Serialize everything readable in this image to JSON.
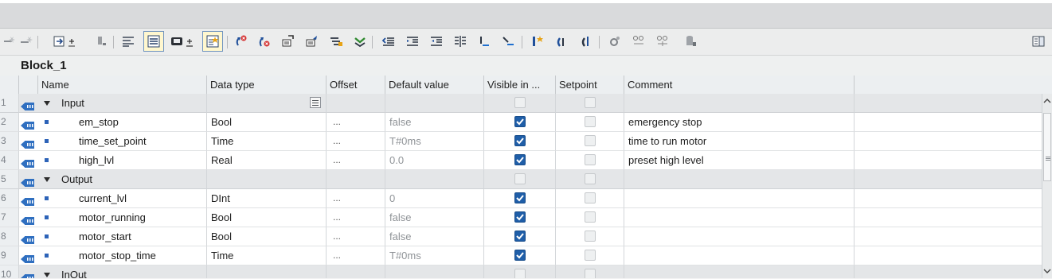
{
  "block": {
    "title": "Block_1"
  },
  "columns": {
    "name": "Name",
    "data_type": "Data type",
    "offset": "Offset",
    "default_value": "Default value",
    "visible_in": "Visible in ...",
    "setpoint": "Setpoint",
    "comment": "Comment"
  },
  "rows": [
    {
      "num": "1",
      "kind": "group",
      "name": "Input",
      "data_type": "",
      "offset": "",
      "default_value": "",
      "visible": false,
      "setpoint": false,
      "comment": ""
    },
    {
      "num": "2",
      "kind": "item",
      "name": "em_stop",
      "data_type": "Bool",
      "offset": "...",
      "default_value": "false",
      "visible": true,
      "setpoint": false,
      "comment": "emergency stop"
    },
    {
      "num": "3",
      "kind": "item",
      "name": "time_set_point",
      "data_type": "Time",
      "offset": "...",
      "default_value": "T#0ms",
      "visible": true,
      "setpoint": false,
      "comment": "time to run motor"
    },
    {
      "num": "4",
      "kind": "item",
      "name": "high_lvl",
      "data_type": "Real",
      "offset": "...",
      "default_value": "0.0",
      "visible": true,
      "setpoint": false,
      "comment": "preset high level"
    },
    {
      "num": "5",
      "kind": "group",
      "name": "Output",
      "data_type": "",
      "offset": "",
      "default_value": "",
      "visible": false,
      "setpoint": false,
      "comment": ""
    },
    {
      "num": "6",
      "kind": "item",
      "name": "current_lvl",
      "data_type": "DInt",
      "offset": "...",
      "default_value": "0",
      "visible": true,
      "setpoint": false,
      "comment": ""
    },
    {
      "num": "7",
      "kind": "item",
      "name": "motor_running",
      "data_type": "Bool",
      "offset": "...",
      "default_value": "false",
      "visible": true,
      "setpoint": false,
      "comment": ""
    },
    {
      "num": "8",
      "kind": "item",
      "name": "motor_start",
      "data_type": "Bool",
      "offset": "...",
      "default_value": "false",
      "visible": true,
      "setpoint": false,
      "comment": ""
    },
    {
      "num": "9",
      "kind": "item",
      "name": "motor_stop_time",
      "data_type": "Time",
      "offset": "...",
      "default_value": "T#0ms",
      "visible": true,
      "setpoint": false,
      "comment": ""
    },
    {
      "num": "10",
      "kind": "group",
      "name": "InOut",
      "data_type": "",
      "offset": "",
      "default_value": "",
      "visible": false,
      "setpoint": false,
      "comment": ""
    }
  ],
  "toolbar": [
    "insert-row-icon",
    "add-row-icon",
    "expand-all-icon",
    "collapse-icon",
    "list-view-icon",
    "structure-view-icon",
    "monitor-icon",
    "snapshot-icon",
    "reset-start-values-icon",
    "reset-values-icon",
    "load-start-values-icon",
    "load-snapshot-icon",
    "copy-snapshot-icon",
    "load-to-start-icon",
    "indent-left-icon",
    "indent-right-icon",
    "outdent-icon",
    "split-icon",
    "filter-up-icon",
    "filter-down-icon",
    "new-tag-icon",
    "refresh-tag-icon",
    "sync-icon",
    "settings-icon",
    "compare-icon",
    "compare-offline-icon",
    "database-icon"
  ],
  "colors": {
    "check_blue": "#1f5ea8",
    "io_icon_blue": "#2f6fc0",
    "selected_tool_yellow": "#fff7cf"
  }
}
